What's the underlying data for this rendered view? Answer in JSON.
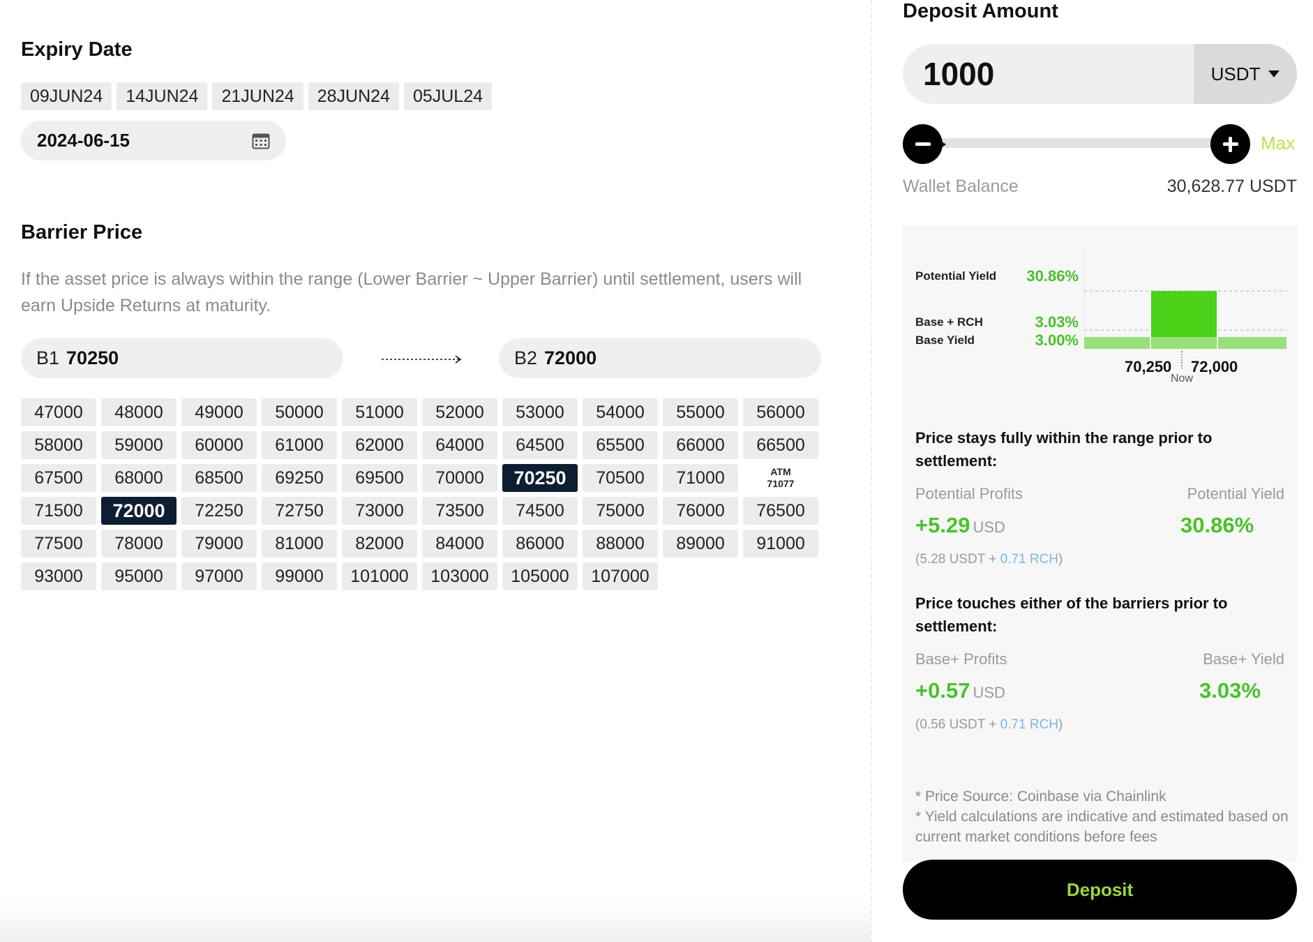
{
  "expiry": {
    "title": "Expiry Date",
    "dates": [
      "09JUN24",
      "14JUN24",
      "21JUN24",
      "28JUN24",
      "05JUL24"
    ],
    "selected_date": "2024-06-15"
  },
  "barrier": {
    "title": "Barrier Price",
    "description": "If the asset price is always within the range (Lower Barrier ~ Upper Barrier) until settlement, users will earn Upside Returns at maturity.",
    "b1_label": "B1",
    "b1_value": "70250",
    "b2_label": "B2",
    "b2_value": "72000",
    "prices": [
      "47000",
      "48000",
      "49000",
      "50000",
      "51000",
      "52000",
      "53000",
      "54000",
      "55000",
      "56000",
      "58000",
      "59000",
      "60000",
      "61000",
      "62000",
      "64000",
      "64500",
      "65500",
      "66000",
      "66500",
      "67500",
      "68000",
      "68500",
      "69250",
      "69500",
      "70000",
      "70250",
      "70500",
      "71000",
      "ATM",
      "71500",
      "72000",
      "72250",
      "72750",
      "73000",
      "73500",
      "74500",
      "75000",
      "76000",
      "76500",
      "77500",
      "78000",
      "79000",
      "81000",
      "82000",
      "84000",
      "86000",
      "88000",
      "89000",
      "91000",
      "93000",
      "95000",
      "97000",
      "99000",
      "101000",
      "103000",
      "105000",
      "107000"
    ],
    "selected": [
      "70250",
      "72000"
    ],
    "atm_label": "ATM",
    "atm_value": "71077"
  },
  "deposit": {
    "title": "Deposit Amount",
    "amount": "1000",
    "currency": "USDT",
    "max_label": "Max",
    "wallet_label": "Wallet Balance",
    "wallet_value": "30,628.77 USDT",
    "button_label": "Deposit"
  },
  "yield_chart": {
    "potential_yield_label": "Potential Yield",
    "potential_yield_value": "30.86%",
    "base_rch_label": "Base + RCH",
    "base_rch_value": "3.03%",
    "base_yield_label": "Base Yield",
    "base_yield_value": "3.00%",
    "lower_barrier_label": "70,250",
    "upper_barrier_label": "72,000",
    "now_label": "Now"
  },
  "scenario_in_range": {
    "title": "Price stays fully within the range prior to settlement:",
    "profits_label": "Potential Profits",
    "yield_label": "Potential Yield",
    "profits_value": "+5.29",
    "profits_unit": "USD",
    "yield_value": "30.86%",
    "breakdown_prefix": "(5.28 USDT + ",
    "breakdown_rch": "0.71 RCH",
    "breakdown_suffix": ")"
  },
  "scenario_touch": {
    "title": "Price touches either of the barriers prior to settlement:",
    "profits_label": "Base+ Profits",
    "yield_label": "Base+ Yield",
    "profits_value": "+0.57",
    "profits_unit": "USD",
    "yield_value": "3.03%",
    "breakdown_prefix": "(0.56 USDT + ",
    "breakdown_rch": "0.71 RCH",
    "breakdown_suffix": ")"
  },
  "notes": {
    "line1": "* Price Source: Coinbase via Chainlink",
    "line2": "* Yield calculations are indicative and estimated based on current market conditions before fees"
  },
  "colors": {
    "accent_green": "#49c22a",
    "selected_cell": "#0e1e32",
    "deposit_text": "#9ad93a",
    "rch_blue": "#7ab7e8"
  }
}
